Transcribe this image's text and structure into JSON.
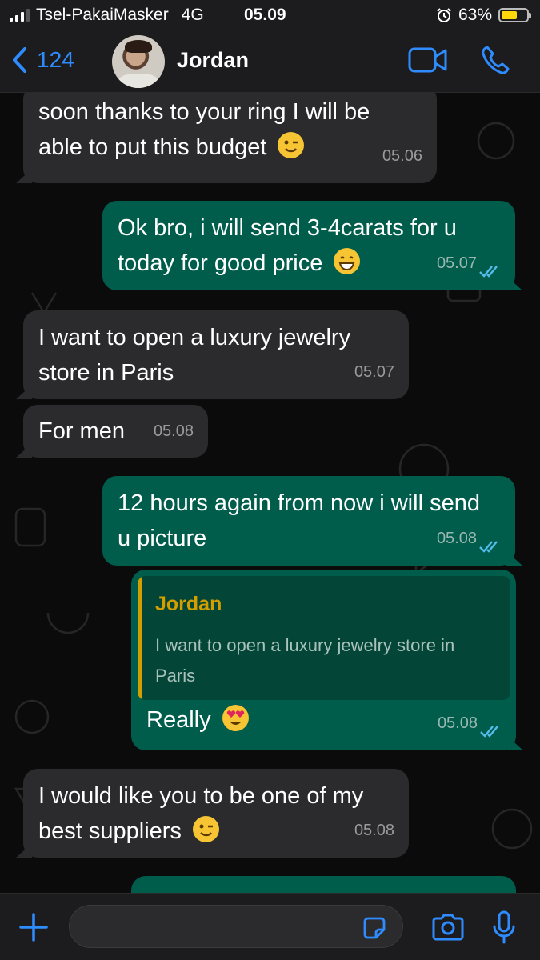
{
  "status_bar": {
    "carrier": "Tsel-PakaiMasker",
    "network": "4G",
    "time": "05.09",
    "battery": "63%",
    "battery_level": 0.63
  },
  "header": {
    "back_count": "124",
    "contact_name": "Jordan"
  },
  "messages": [
    {
      "dir": "in",
      "text1": "soon thanks to your ring I will be",
      "text2": "able to put this budget",
      "emoji": "winking-face",
      "time": "05.06"
    },
    {
      "dir": "out",
      "text1": "Ok bro, i will send 3-4carats for u",
      "text2": "today for good price",
      "emoji": "grinning-face",
      "time": "05.07",
      "status": "read"
    },
    {
      "dir": "in",
      "text1": "I want to open a luxury jewelry",
      "text2": "store in Paris",
      "time": "05.07"
    },
    {
      "dir": "in",
      "text1": "For men",
      "time": "05.08"
    },
    {
      "dir": "out",
      "text1": "12 hours again from now i will send",
      "text2": "u picture",
      "time": "05.08",
      "status": "read"
    },
    {
      "dir": "out",
      "reply_to": {
        "name": "Jordan",
        "text": "I want to open a luxury jewelry store in Paris"
      },
      "text1": "Really",
      "emoji": "heart-eyes",
      "time": "05.08",
      "status": "read"
    },
    {
      "dir": "in",
      "text1": "I would like you to be one of my",
      "text2": "best suppliers",
      "emoji": "winking-face",
      "time": "05.08"
    }
  ],
  "input": {
    "value": "",
    "placeholder": ""
  },
  "colors": {
    "accent": "#2f8cff",
    "outgoing_bubble": "#005c4b",
    "incoming_bubble": "#2b2b2d",
    "quote_name": "#d39e00",
    "read_ticks": "#53bdeb"
  }
}
